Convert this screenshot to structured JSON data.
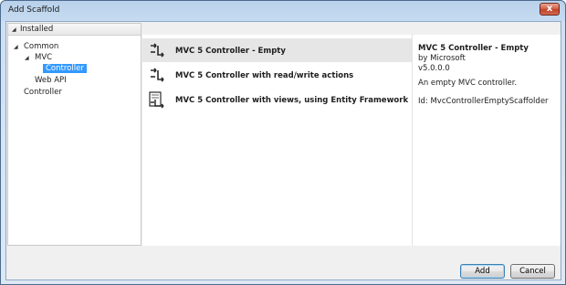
{
  "window": {
    "title": "Add Scaffold",
    "close_glyph": "x"
  },
  "tree": {
    "header": "Installed",
    "items": [
      {
        "label": "Common",
        "level": 1,
        "expanded": true,
        "selected": false
      },
      {
        "label": "MVC",
        "level": 2,
        "expanded": true,
        "selected": false
      },
      {
        "label": "Controller",
        "level": 3,
        "selected": true
      },
      {
        "label": "Web API",
        "level": 2,
        "selected": false
      },
      {
        "label": "Controller",
        "level": 1,
        "selected": false
      }
    ]
  },
  "templates": [
    {
      "label": "MVC 5 Controller - Empty",
      "icon": "controller-icon",
      "selected": true
    },
    {
      "label": "MVC 5 Controller with read/write actions",
      "icon": "controller-icon",
      "selected": false
    },
    {
      "label": "MVC 5 Controller with views, using Entity Framework",
      "icon": "controller-views-icon",
      "selected": false
    }
  ],
  "details": {
    "title": "MVC 5 Controller - Empty",
    "author": "by Microsoft",
    "version": "v5.0.0.0",
    "description": "An empty MVC controller.",
    "id": "Id: MvcControllerEmptyScaffolder"
  },
  "buttons": {
    "add": "Add",
    "cancel": "Cancel"
  },
  "colors": {
    "selection": "#3399ff",
    "title_gradient": "#b9d1ea",
    "close": "#c0432a"
  }
}
